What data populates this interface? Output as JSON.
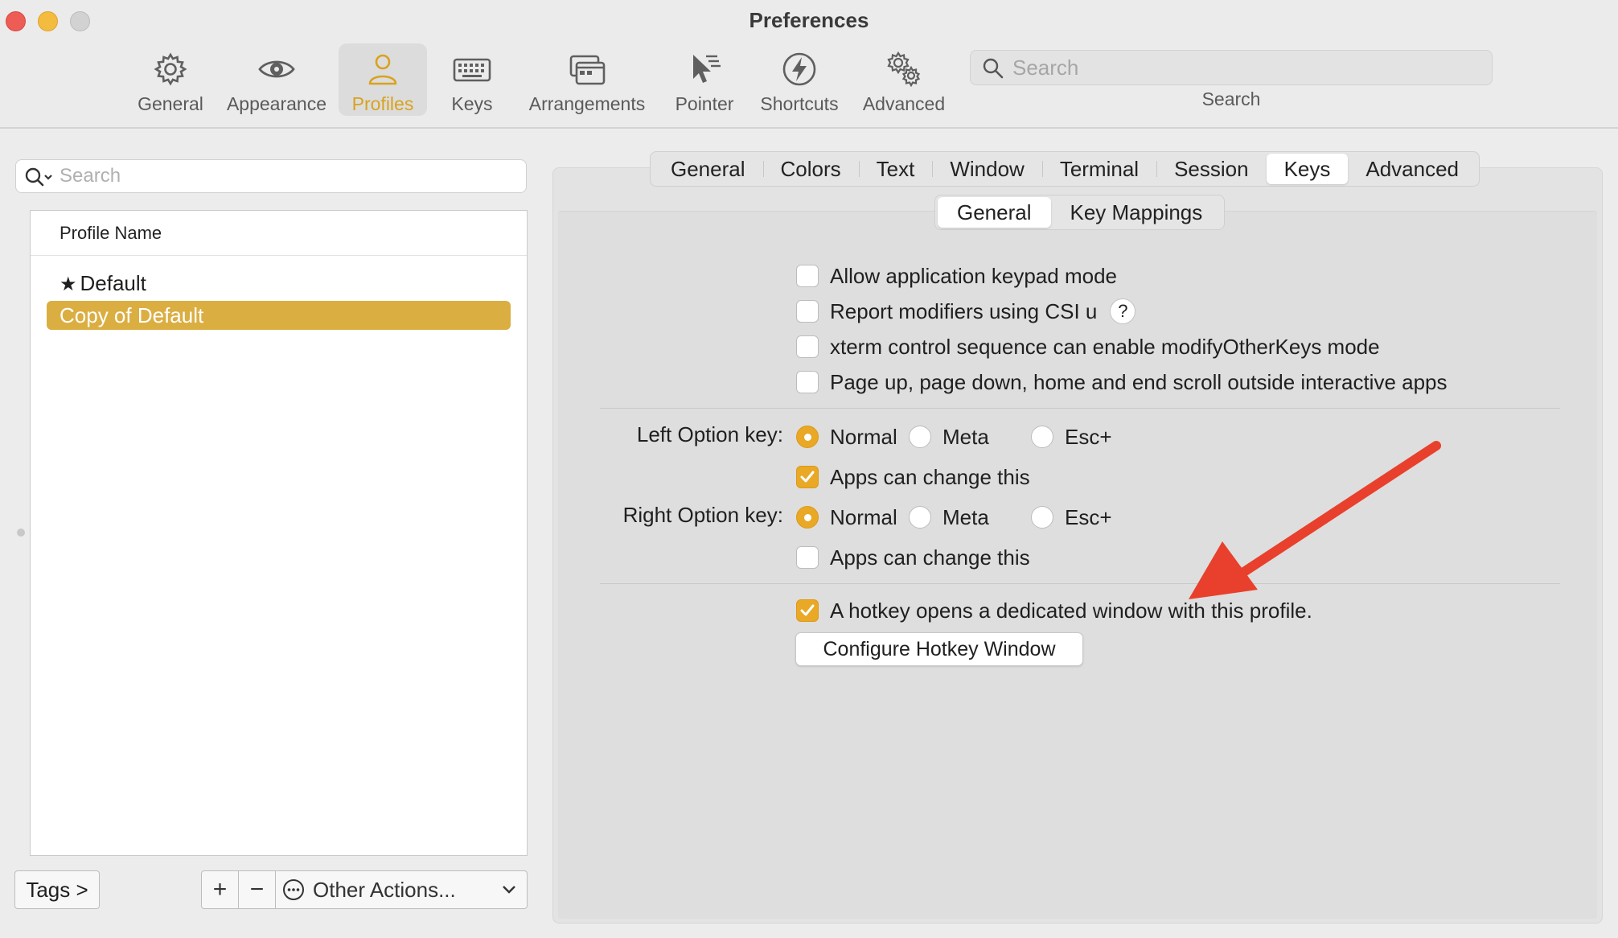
{
  "window": {
    "title": "Preferences"
  },
  "toolbar": {
    "items": [
      {
        "label": "General",
        "icon": "gear-icon"
      },
      {
        "label": "Appearance",
        "icon": "eye-icon"
      },
      {
        "label": "Profiles",
        "icon": "person-icon",
        "selected": true
      },
      {
        "label": "Keys",
        "icon": "keyboard-icon"
      },
      {
        "label": "Arrangements",
        "icon": "windows-icon"
      },
      {
        "label": "Pointer",
        "icon": "pointer-icon"
      },
      {
        "label": "Shortcuts",
        "icon": "lightning-icon"
      },
      {
        "label": "Advanced",
        "icon": "gears-icon"
      }
    ],
    "search": {
      "placeholder": "Search",
      "label": "Search"
    }
  },
  "profiles": {
    "search_placeholder": "Search",
    "header": "Profile Name",
    "rows": [
      {
        "name": "Default",
        "default": true
      },
      {
        "name": "Copy of Default",
        "selected": true
      }
    ],
    "tags_button": "Tags >",
    "add_glyph": "+",
    "remove_glyph": "−",
    "other_actions": "Other Actions..."
  },
  "tabs": [
    "General",
    "Colors",
    "Text",
    "Window",
    "Terminal",
    "Session",
    "Keys",
    "Advanced"
  ],
  "active_tab": "Keys",
  "subtabs": [
    "General",
    "Key Mappings"
  ],
  "active_subtab": "General",
  "keys_general": {
    "checkboxes": [
      {
        "label": "Allow application keypad mode",
        "checked": false
      },
      {
        "label": "Report modifiers using CSI u",
        "checked": false,
        "help": "?"
      },
      {
        "label": "xterm control sequence can enable modifyOtherKeys mode",
        "checked": false
      },
      {
        "label": "Page up, page down, home and end scroll outside interactive apps",
        "checked": false
      }
    ],
    "left_option": {
      "label": "Left Option key:",
      "options": [
        "Normal",
        "Meta",
        "Esc+"
      ],
      "selected": "Normal",
      "apps_can_change": {
        "label": "Apps can change this",
        "checked": true
      }
    },
    "right_option": {
      "label": "Right Option key:",
      "options": [
        "Normal",
        "Meta",
        "Esc+"
      ],
      "selected": "Normal",
      "apps_can_change": {
        "label": "Apps can change this",
        "checked": false
      }
    },
    "hotkey": {
      "label": "A hotkey opens a dedicated window with this profile.",
      "checked": true
    },
    "configure_button": "Configure Hotkey Window"
  },
  "colors": {
    "accent": "#e9a825",
    "selection": "#dbae42",
    "annotation_arrow": "#e8402c"
  }
}
